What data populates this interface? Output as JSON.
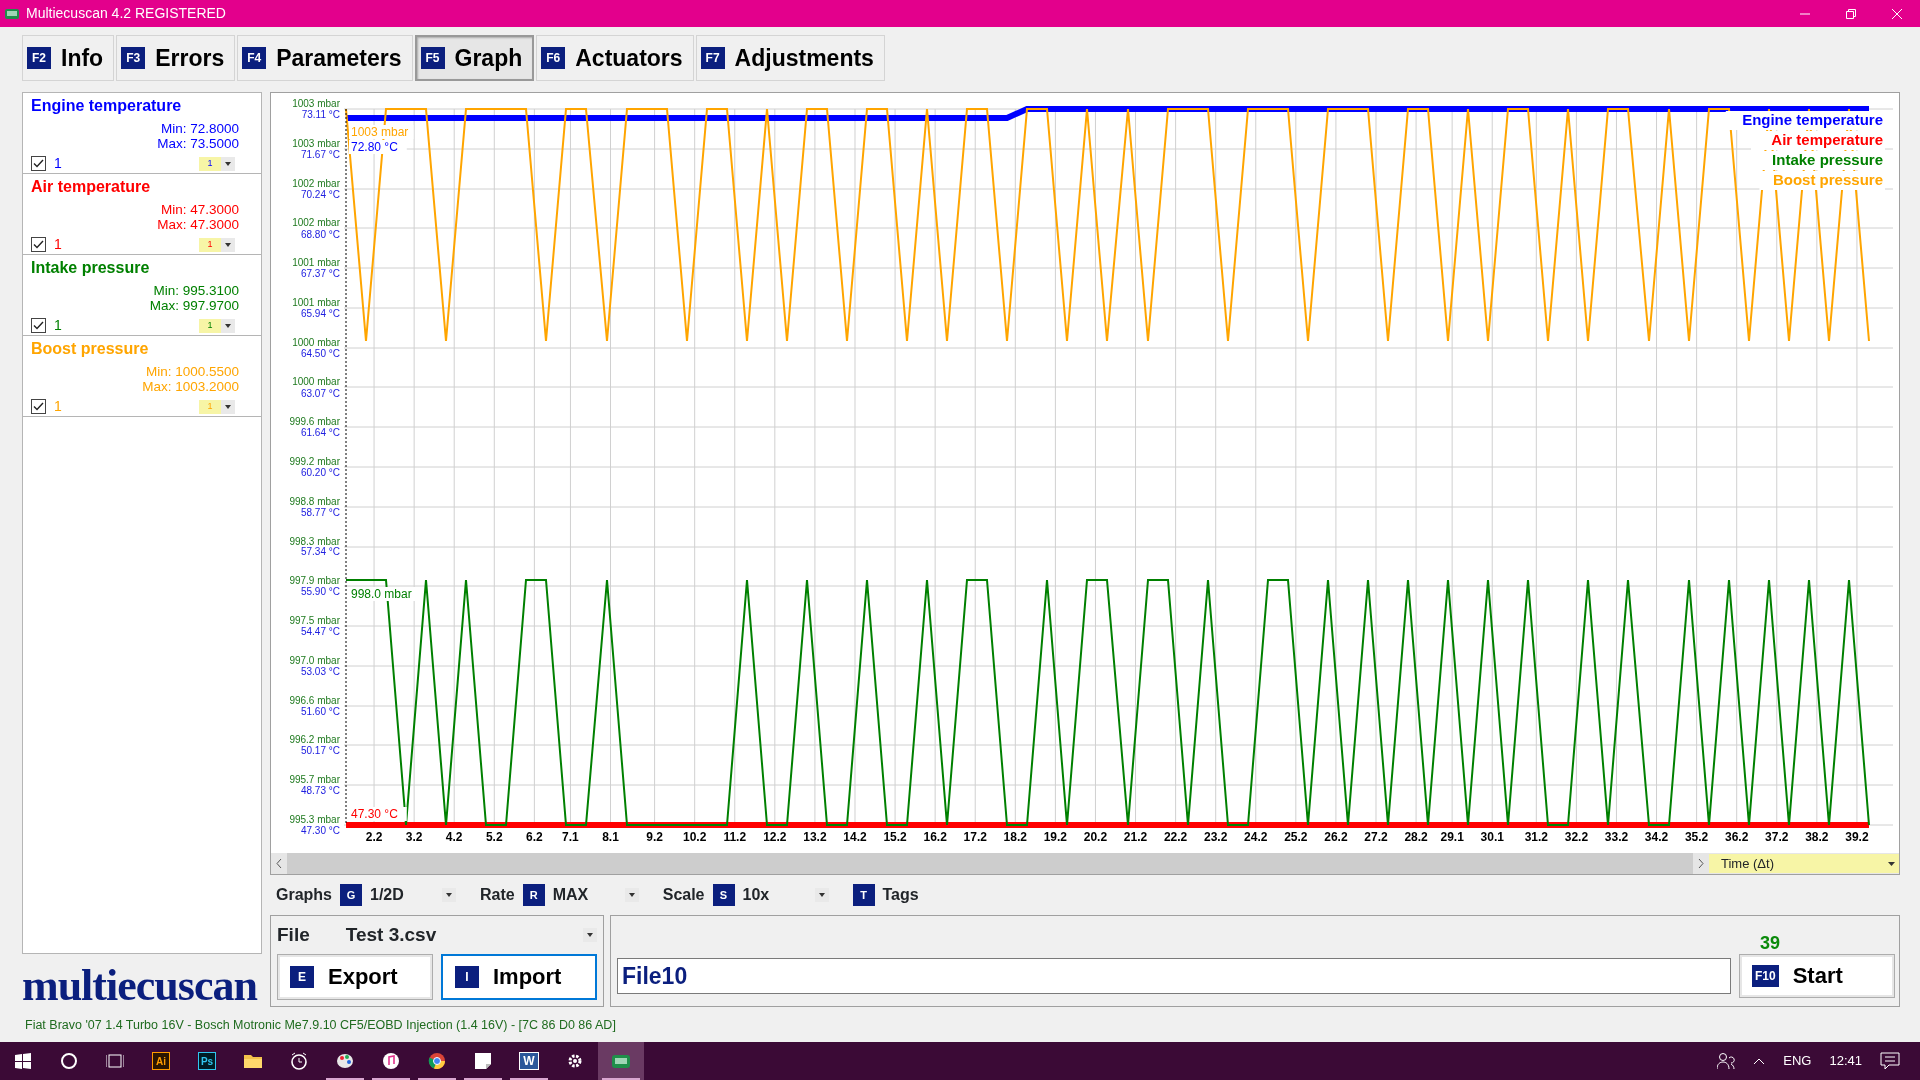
{
  "window": {
    "title": "Multiecuscan 4.2 REGISTERED"
  },
  "tabs": [
    {
      "key": "F2",
      "label": "Info",
      "selected": false
    },
    {
      "key": "F3",
      "label": "Errors",
      "selected": false
    },
    {
      "key": "F4",
      "label": "Parameters",
      "selected": false
    },
    {
      "key": "F5",
      "label": "Graph",
      "selected": true
    },
    {
      "key": "F6",
      "label": "Actuators",
      "selected": false
    },
    {
      "key": "F7",
      "label": "Adjustments",
      "selected": false
    }
  ],
  "channels": [
    {
      "name": "Engine temperature",
      "color": "#0000ff",
      "min": "Min: 72.8000",
      "max": "Max: 73.5000",
      "checked": true,
      "label": "1",
      "scale": "1"
    },
    {
      "name": "Air temperature",
      "color": "#ff0000",
      "min": "Min: 47.3000",
      "max": "Max: 47.3000",
      "checked": true,
      "label": "1",
      "scale": "1"
    },
    {
      "name": "Intake pressure",
      "color": "#008000",
      "min": "Min: 995.3100",
      "max": "Max: 997.9700",
      "checked": true,
      "label": "1",
      "scale": "1"
    },
    {
      "name": "Boost pressure",
      "color": "#ffa500",
      "min": "Min: 1000.5500",
      "max": "Max: 1003.2000",
      "checked": true,
      "label": "1",
      "scale": "1"
    }
  ],
  "logo": "multiecuscan",
  "graph": {
    "chart_data": {
      "type": "line",
      "grid": true,
      "x": [
        1.5,
        2,
        2.5,
        3,
        3.5,
        4,
        4.5,
        5,
        5.5,
        6,
        6.5,
        7,
        7.5,
        8,
        8.5,
        9,
        9.5,
        10,
        10.5,
        11,
        11.5,
        12,
        12.5,
        13,
        13.5,
        14,
        14.5,
        15,
        15.5,
        16,
        16.5,
        17,
        17.5,
        18,
        18.5,
        19,
        19.5,
        20,
        20.5,
        21,
        21.5,
        22,
        22.5,
        23,
        23.5,
        24,
        24.5,
        25,
        25.5,
        26,
        26.5,
        27,
        27.5,
        28,
        28.5,
        29,
        29.5,
        30,
        30.5,
        31,
        31.5,
        32,
        32.5,
        33,
        33.5,
        34,
        34.5,
        35,
        35.5,
        36,
        36.5,
        37,
        37.5,
        38,
        38.5,
        39,
        39.5
      ],
      "xlabel": "Time (Δt)",
      "xlim": [
        1.45,
        40.1
      ],
      "xticks": [
        2.2,
        3.2,
        4.2,
        5.2,
        6.2,
        7.1,
        8.1,
        9.2,
        10.2,
        11.2,
        12.2,
        13.2,
        14.2,
        15.2,
        16.2,
        17.2,
        18.2,
        19.2,
        20.2,
        21.2,
        22.2,
        23.2,
        24.2,
        25.2,
        26.2,
        27.2,
        28.2,
        29.1,
        30.1,
        31.2,
        32.2,
        33.2,
        34.2,
        35.2,
        36.2,
        37.2,
        38.2,
        39.2
      ],
      "ylim": [
        995.32,
        1003.06
      ],
      "yticks": [
        {
          "value": 1003.06,
          "label": "1003 mbar"
        },
        {
          "value": 1002.63,
          "label": "1003 mbar"
        },
        {
          "value": 1002.2,
          "label": "1002 mbar"
        },
        {
          "value": 1001.77,
          "label": "1002 mbar"
        },
        {
          "value": 1001.34,
          "label": "1001 mbar"
        },
        {
          "value": 1000.91,
          "label": "1001 mbar"
        },
        {
          "value": 1000.48,
          "label": "1000 mbar"
        },
        {
          "value": 1000.05,
          "label": "1000 mbar"
        },
        {
          "value": 999.62,
          "label": "999.6 mbar"
        },
        {
          "value": 999.19,
          "label": "999.2 mbar"
        },
        {
          "value": 998.76,
          "label": "998.8 mbar"
        },
        {
          "value": 998.33,
          "label": "998.3 mbar"
        },
        {
          "value": 997.9,
          "label": "997.9 mbar"
        },
        {
          "value": 997.47,
          "label": "997.5 mbar"
        },
        {
          "value": 997.04,
          "label": "997.0 mbar"
        },
        {
          "value": 996.61,
          "label": "996.6 mbar"
        },
        {
          "value": 996.18,
          "label": "996.2 mbar"
        },
        {
          "value": 995.75,
          "label": "995.7 mbar"
        },
        {
          "value": 995.32,
          "label": "995.3 mbar"
        }
      ],
      "y2lim": [
        47.3,
        73.11
      ],
      "y2ticks": [
        {
          "value": 73.11,
          "label": "73.11 °C"
        },
        {
          "value": 71.67,
          "label": "71.67 °C"
        },
        {
          "value": 70.24,
          "label": "70.24 °C"
        },
        {
          "value": 68.8,
          "label": "68.80 °C"
        },
        {
          "value": 67.37,
          "label": "67.37 °C"
        },
        {
          "value": 65.94,
          "label": "65.94 °C"
        },
        {
          "value": 64.5,
          "label": "64.50 °C"
        },
        {
          "value": 63.07,
          "label": "63.07 °C"
        },
        {
          "value": 61.64,
          "label": "61.64 °C"
        },
        {
          "value": 60.2,
          "label": "60.20 °C"
        },
        {
          "value": 58.77,
          "label": "58.77 °C"
        },
        {
          "value": 57.34,
          "label": "57.34 °C"
        },
        {
          "value": 55.9,
          "label": "55.90 °C"
        },
        {
          "value": 54.47,
          "label": "54.47 °C"
        },
        {
          "value": 53.03,
          "label": "53.03 °C"
        },
        {
          "value": 51.6,
          "label": "51.60 °C"
        },
        {
          "value": 50.17,
          "label": "50.17 °C"
        },
        {
          "value": 48.73,
          "label": "48.73 °C"
        },
        {
          "value": 47.3,
          "label": "47.30 °C"
        }
      ],
      "series": [
        {
          "name": "Engine temperature",
          "color": "#0000ff",
          "axis": "y2",
          "values": [
            72.8,
            72.8,
            72.8,
            72.8,
            72.8,
            72.8,
            72.8,
            72.8,
            72.8,
            72.8,
            72.8,
            72.8,
            72.8,
            72.8,
            72.8,
            72.8,
            72.8,
            72.8,
            72.8,
            72.8,
            72.8,
            72.8,
            72.8,
            72.8,
            72.8,
            72.8,
            72.8,
            72.8,
            72.8,
            72.8,
            72.8,
            72.8,
            72.8,
            72.8,
            73.11,
            73.11,
            73.11,
            73.11,
            73.11,
            73.11,
            73.11,
            73.11,
            73.11,
            73.11,
            73.11,
            73.11,
            73.11,
            73.11,
            73.11,
            73.11,
            73.11,
            73.11,
            73.11,
            73.11,
            73.11,
            73.11,
            73.11,
            73.11,
            73.11,
            73.11,
            73.11,
            73.11,
            73.11,
            73.11,
            73.11,
            73.11,
            73.11,
            73.11,
            73.11,
            73.11,
            73.11,
            73.11,
            73.11,
            73.11,
            73.11,
            73.11,
            73.11
          ]
        },
        {
          "name": "Air temperature",
          "color": "#ff0000",
          "axis": "y2",
          "values": [
            47.3,
            47.3,
            47.3,
            47.3,
            47.3,
            47.3,
            47.3,
            47.3,
            47.3,
            47.3,
            47.3,
            47.3,
            47.3,
            47.3,
            47.3,
            47.3,
            47.3,
            47.3,
            47.3,
            47.3,
            47.3,
            47.3,
            47.3,
            47.3,
            47.3,
            47.3,
            47.3,
            47.3,
            47.3,
            47.3,
            47.3,
            47.3,
            47.3,
            47.3,
            47.3,
            47.3,
            47.3,
            47.3,
            47.3,
            47.3,
            47.3,
            47.3,
            47.3,
            47.3,
            47.3,
            47.3,
            47.3,
            47.3,
            47.3,
            47.3,
            47.3,
            47.3,
            47.3,
            47.3,
            47.3,
            47.3,
            47.3,
            47.3,
            47.3,
            47.3,
            47.3,
            47.3,
            47.3,
            47.3,
            47.3,
            47.3,
            47.3,
            47.3,
            47.3,
            47.3,
            47.3,
            47.3,
            47.3,
            47.3,
            47.3,
            47.3,
            47.3
          ]
        },
        {
          "name": "Intake pressure",
          "color": "#008000",
          "axis": "y",
          "values": [
            997.97,
            997.97,
            997.97,
            995.32,
            997.97,
            995.32,
            997.97,
            995.32,
            995.32,
            997.97,
            997.97,
            995.32,
            995.32,
            997.97,
            995.32,
            995.32,
            995.32,
            995.32,
            995.32,
            995.32,
            997.97,
            995.32,
            995.32,
            997.97,
            995.32,
            995.32,
            997.97,
            995.32,
            995.32,
            997.97,
            995.32,
            997.97,
            997.97,
            995.32,
            995.32,
            997.97,
            995.32,
            997.97,
            997.97,
            995.32,
            997.97,
            997.97,
            995.32,
            997.97,
            995.32,
            995.32,
            997.97,
            997.97,
            995.32,
            997.97,
            995.32,
            997.97,
            995.32,
            997.97,
            995.32,
            997.97,
            995.32,
            997.97,
            995.32,
            997.97,
            995.32,
            995.32,
            997.97,
            995.32,
            997.97,
            995.32,
            995.32,
            997.97,
            995.32,
            997.97,
            995.32,
            997.97,
            995.32,
            997.97,
            995.32,
            997.97,
            995.32
          ]
        },
        {
          "name": "Boost pressure",
          "color": "#ffa500",
          "axis": "y",
          "values": [
            1003.06,
            1000.55,
            1003.06,
            1003.06,
            1003.06,
            1000.55,
            1003.06,
            1003.06,
            1003.06,
            1003.06,
            1000.55,
            1003.06,
            1003.06,
            1000.55,
            1003.06,
            1003.06,
            1003.06,
            1000.55,
            1003.06,
            1003.06,
            1000.55,
            1003.06,
            1000.55,
            1003.06,
            1003.06,
            1000.55,
            1003.06,
            1003.06,
            1000.55,
            1003.06,
            1000.55,
            1003.06,
            1003.06,
            1000.55,
            1003.06,
            1003.06,
            1000.55,
            1003.06,
            1000.55,
            1003.06,
            1000.55,
            1003.06,
            1003.06,
            1003.06,
            1000.55,
            1003.06,
            1003.06,
            1003.06,
            1000.55,
            1003.06,
            1003.06,
            1003.06,
            1000.55,
            1003.06,
            1003.06,
            1000.55,
            1003.06,
            1000.55,
            1003.06,
            1003.06,
            1000.55,
            1003.06,
            1000.55,
            1003.06,
            1003.06,
            1000.55,
            1003.06,
            1000.55,
            1003.06,
            1003.06,
            1000.55,
            1003.06,
            1000.55,
            1003.06,
            1000.55,
            1003.06,
            1000.55
          ]
        }
      ],
      "annotations": [
        "72.80 °C",
        "47.30 °C",
        "998.0 mbar",
        "1003 mbar"
      ]
    }
  },
  "controls": [
    {
      "kind": "dropdown",
      "label": "Graphs",
      "key": "G",
      "value": "1/2D"
    },
    {
      "kind": "dropdown",
      "label": "Rate",
      "key": "R",
      "value": "MAX"
    },
    {
      "kind": "dropdown",
      "label": "Scale",
      "key": "S",
      "value": "10x"
    },
    {
      "kind": "toggle",
      "key": "T",
      "label": "Tags"
    }
  ],
  "file": {
    "label": "File",
    "value": "Test 3.csv"
  },
  "buttons": [
    {
      "key": "E",
      "label": "Export",
      "focused": false
    },
    {
      "key": "I",
      "label": "Import",
      "focused": true
    }
  ],
  "counter": "39",
  "filename": {
    "value": "File10"
  },
  "start": {
    "key": "F10",
    "label": "Start"
  },
  "status_bar": "Fiat Bravo '07 1.4 Turbo 16V - Bosch Motronic Me7.9.10 CF5/EOBD Injection (1.4 16V) - [7C 86 D0 86 AD]",
  "taskbar": {
    "apps": [
      {
        "kind": "illustrator",
        "text": "Ai",
        "running": false,
        "selected": false
      },
      {
        "kind": "photoshop",
        "text": "Ps",
        "running": false,
        "selected": false
      },
      {
        "kind": "folder",
        "running": false,
        "selected": false
      },
      {
        "kind": "alarm",
        "running": false,
        "selected": false
      },
      {
        "kind": "paint",
        "running": true,
        "selected": false
      },
      {
        "kind": "music",
        "running": true,
        "selected": false
      },
      {
        "kind": "browser",
        "running": true,
        "selected": false
      },
      {
        "kind": "note",
        "running": true,
        "selected": false
      },
      {
        "kind": "word",
        "text": "W",
        "running": true,
        "selected": false
      },
      {
        "kind": "gear",
        "running": false,
        "selected": false
      },
      {
        "kind": "app",
        "running": true,
        "selected": true
      }
    ],
    "language": "ENG",
    "time": "12:41"
  }
}
